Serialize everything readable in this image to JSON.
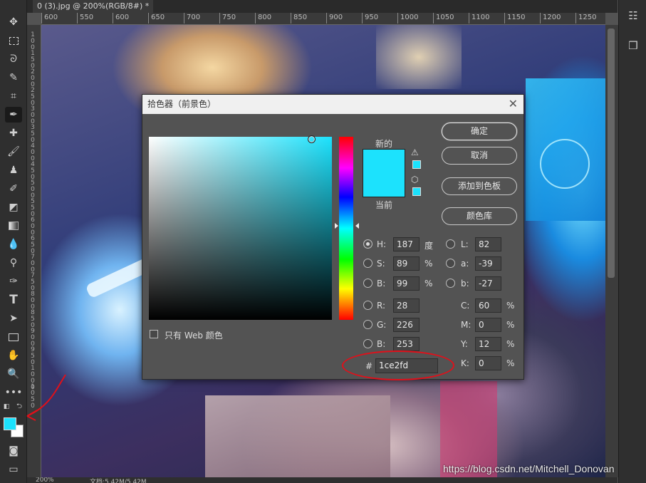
{
  "document": {
    "tab_title": "0 (3).jpg @ 200%(RGB/8#) *",
    "zoom": "200%",
    "doc_info": "文档:5.42M/5.42M"
  },
  "ruler": {
    "top_ticks": [
      "600",
      "550",
      "600",
      "650",
      "700",
      "750",
      "800",
      "850",
      "900",
      "950",
      "1000",
      "1050",
      "1100",
      "1150",
      "1200",
      "1250"
    ],
    "left_ticks": [
      "1\n0\n0",
      "1\n5\n0",
      "2\n0\n0",
      "2\n5\n0",
      "3\n0\n0",
      "3\n5\n0",
      "4\n0\n0",
      "4\n5\n0",
      "5\n0\n0",
      "5\n5\n0",
      "6\n0\n0",
      "6\n5\n0",
      "7\n0\n0",
      "7\n5\n0",
      "8\n0\n0",
      "8\n5\n0",
      "9\n0\n0",
      "9\n5\n0",
      "1\n0\n0\n0",
      "1\n0\n5\n0"
    ]
  },
  "toolbar": {
    "tools": [
      "move-tool",
      "marquee-tool",
      "lasso-tool",
      "quick-select-tool",
      "crop-tool",
      "eyedropper-tool",
      "healing-brush-tool",
      "brush-tool",
      "clone-stamp-tool",
      "history-brush-tool",
      "eraser-tool",
      "gradient-tool",
      "blur-tool",
      "dodge-tool",
      "pen-tool",
      "type-tool",
      "path-select-tool",
      "rectangle-tool",
      "hand-tool",
      "zoom-tool",
      "more-tools"
    ],
    "foreground_color": "#1ce2fd",
    "background_color": "#ffffff"
  },
  "dialog": {
    "title": "拾色器（前景色）",
    "new_label": "新的",
    "current_label": "当前",
    "buttons": {
      "ok": "确定",
      "cancel": "取消",
      "add_to_swatches": "添加到色板",
      "color_libraries": "颜色库"
    },
    "fields": {
      "H": {
        "label": "H:",
        "value": "187",
        "unit": "度"
      },
      "S": {
        "label": "S:",
        "value": "89",
        "unit": "%"
      },
      "Bv": {
        "label": "B:",
        "value": "99",
        "unit": "%"
      },
      "R": {
        "label": "R:",
        "value": "28"
      },
      "G": {
        "label": "G:",
        "value": "226"
      },
      "Bb": {
        "label": "B:",
        "value": "253"
      },
      "L": {
        "label": "L:",
        "value": "82"
      },
      "a": {
        "label": "a:",
        "value": "-39"
      },
      "b": {
        "label": "b:",
        "value": "-27"
      },
      "C": {
        "label": "C:",
        "value": "60",
        "unit": "%"
      },
      "M": {
        "label": "M:",
        "value": "0",
        "unit": "%"
      },
      "Y": {
        "label": "Y:",
        "value": "12",
        "unit": "%"
      },
      "K": {
        "label": "K:",
        "value": "0",
        "unit": "%"
      }
    },
    "selected_mode": "H",
    "web_colors_only": "只有 Web 颜色",
    "hex_label": "#",
    "hex_value": "1ce2fd",
    "selected_color": "#1ce2fd"
  },
  "watermark": "https://blog.csdn.net/Mitchell_Donovan",
  "annotation_color": "#e0101a"
}
